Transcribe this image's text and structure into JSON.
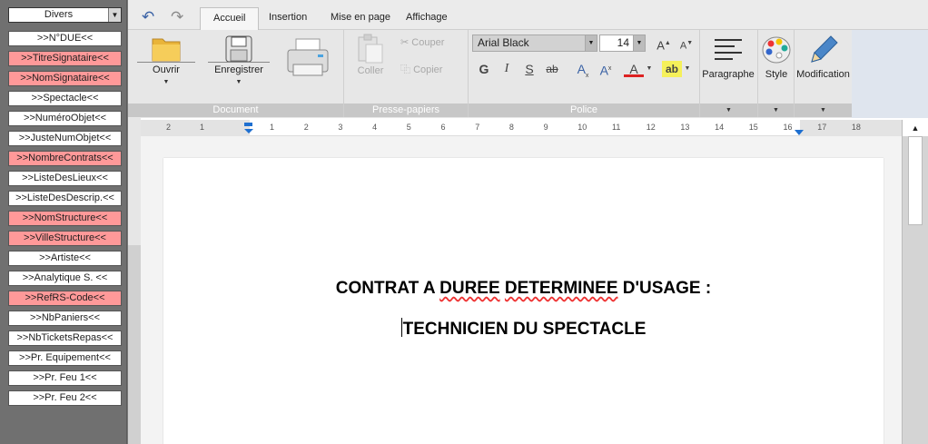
{
  "sidebar": {
    "select_value": "Divers",
    "buttons": [
      {
        "label": ">>N°DUE<<",
        "highlight": false
      },
      {
        "label": ">>TitreSignataire<<",
        "highlight": true
      },
      {
        "label": ">>NomSignataire<<",
        "highlight": true
      },
      {
        "label": ">>Spectacle<<",
        "highlight": false
      },
      {
        "label": ">>NuméroObjet<<",
        "highlight": false
      },
      {
        "label": ">>JusteNumObjet<<",
        "highlight": false
      },
      {
        "label": ">>NombreContrats<<",
        "highlight": true
      },
      {
        "label": ">>ListeDesLieux<<",
        "highlight": false
      },
      {
        "label": ">>ListeDesDescrip.<<",
        "highlight": false
      },
      {
        "label": ">>NomStructure<<",
        "highlight": true
      },
      {
        "label": ">>VilleStructure<<",
        "highlight": true
      },
      {
        "label": ">>Artiste<<",
        "highlight": false
      },
      {
        "label": ">>Analytique S. <<",
        "highlight": false
      },
      {
        "label": ">>RefRS-Code<<",
        "highlight": true
      },
      {
        "label": ">>NbPaniers<<",
        "highlight": false
      },
      {
        "label": ">>NbTicketsRepas<<",
        "highlight": false
      },
      {
        "label": ">>Pr. Equipement<<",
        "highlight": false
      },
      {
        "label": ">>Pr. Feu 1<<",
        "highlight": false
      },
      {
        "label": ">>Pr. Feu 2<<",
        "highlight": false
      }
    ],
    "highlight_color": "#ff9999"
  },
  "tabs": [
    "Accueil",
    "Insertion",
    "Mise en page",
    "Affichage"
  ],
  "active_tab": "Accueil",
  "ribbon": {
    "document": {
      "label": "Document",
      "open": "Ouvrir",
      "save": "Enregistrer"
    },
    "clipboard": {
      "label": "Presse-papiers",
      "paste": "Coller",
      "cut": "Couper",
      "copy": "Copier"
    },
    "font": {
      "label": "Police",
      "name": "Arial Black",
      "size": "14"
    },
    "paragraph": "Paragraphe",
    "style": "Style",
    "modification": "Modification"
  },
  "ruler_ticks": [
    "2",
    "1",
    "1",
    "2",
    "3",
    "4",
    "5",
    "6",
    "7",
    "8",
    "9",
    "10",
    "11",
    "12",
    "13",
    "14",
    "15",
    "16",
    "17",
    "18"
  ],
  "document": {
    "title_prefix": "CONTRAT A ",
    "title_w1": "DUREE",
    "title_w2": "DETERMINEE",
    "title_suffix": " D'USAGE :",
    "subtitle": "TECHNICIEN DU SPECTACLE"
  },
  "accent_color": "#3a62a5"
}
